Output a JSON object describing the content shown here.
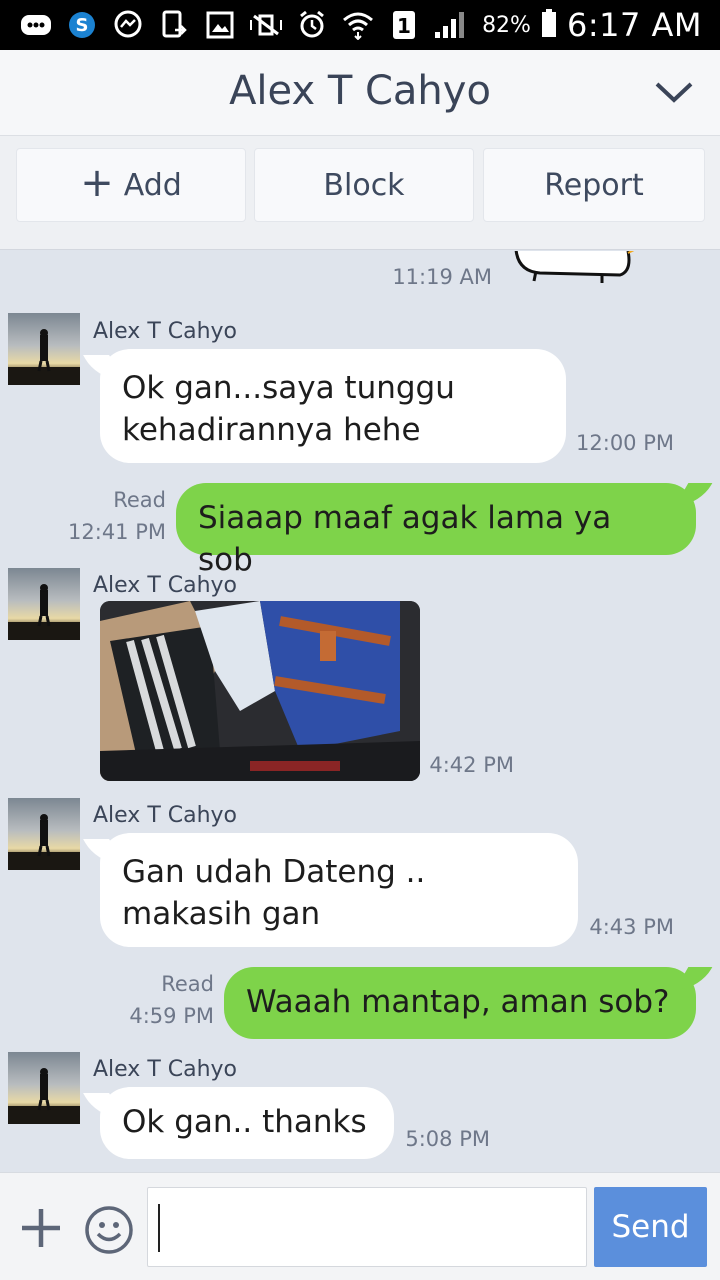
{
  "status_bar": {
    "battery_percent": "82%",
    "time": "6:17 AM",
    "sim_badge": "1"
  },
  "header": {
    "title": "Alex T Cahyo"
  },
  "actions": {
    "add_label": "Add",
    "block_label": "Block",
    "report_label": "Report"
  },
  "messages": [
    {
      "type": "sticker-partial",
      "time": "11:19 AM"
    },
    {
      "type": "incoming",
      "sender": "Alex T Cahyo",
      "text": "Ok gan...saya tunggu kehadirannya hehe",
      "time": "12:00 PM"
    },
    {
      "type": "outgoing",
      "status": "Read",
      "time": "12:41 PM",
      "text": "Siaaap maaf agak lama ya sob"
    },
    {
      "type": "incoming-photo",
      "sender": "Alex T Cahyo",
      "time": "4:42 PM"
    },
    {
      "type": "incoming",
      "sender": "Alex T Cahyo",
      "text": "Gan udah Dateng .. makasih gan",
      "time": "4:43 PM"
    },
    {
      "type": "outgoing",
      "status": "Read",
      "time": "4:59 PM",
      "text": "Waaah mantap, aman sob?"
    },
    {
      "type": "incoming",
      "sender": "Alex T Cahyo",
      "text": "Ok gan.. thanks",
      "time": "5:08 PM"
    }
  ],
  "composer": {
    "send_label": "Send",
    "input_value": ""
  },
  "colors": {
    "outgoing_bubble": "#7ed34a",
    "send_button": "#5b8fdc",
    "chat_background": "#dfe4ec"
  }
}
